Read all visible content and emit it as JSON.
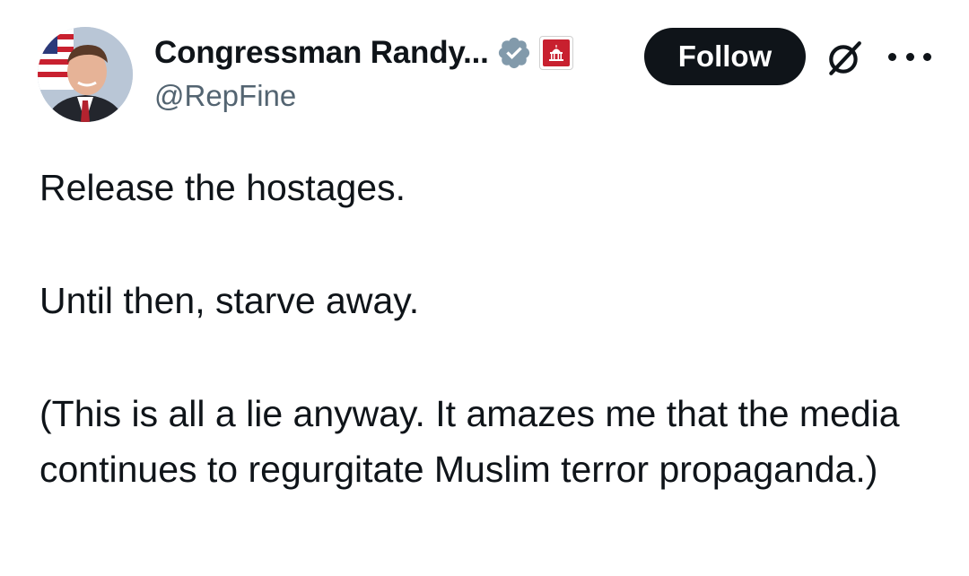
{
  "author": {
    "display_name": "Congressman Randy...",
    "handle": "@RepFine",
    "avatar_icon": "avatar-photo",
    "verified_icon": "verified-badge-icon",
    "affiliation_icon": "us-capitol-badge-icon"
  },
  "actions": {
    "follow_label": "Follow",
    "grok_icon": "grok-icon",
    "more_icon": "more-icon"
  },
  "tweet": {
    "line1": "Release the hostages.",
    "line2": "Until then, starve away.",
    "line3": "(This is all a lie anyway.  It amazes me that the media continues to regurgitate Muslim terror propaganda.)"
  },
  "colors": {
    "text": "#0f1419",
    "secondary": "#536471",
    "verified": "#829aab",
    "affiliation": "#c8202f"
  }
}
